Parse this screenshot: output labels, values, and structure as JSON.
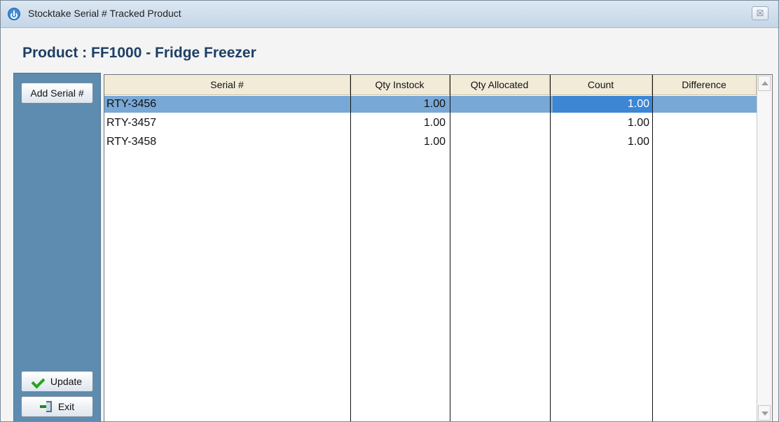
{
  "window": {
    "title": "Stocktake Serial # Tracked Product",
    "close_symbol": "☒"
  },
  "product_heading": "Product : FF1000 - Fridge Freezer",
  "buttons": {
    "add_serial": "Add Serial #",
    "update": "Update",
    "exit": "Exit"
  },
  "table": {
    "columns": [
      "Serial #",
      "Qty Instock",
      "Qty Allocated",
      "Count",
      "Difference"
    ],
    "rows": [
      {
        "serial": "RTY-3456",
        "qty_instock": "1.00",
        "qty_allocated": "",
        "count": "1.00",
        "difference": ""
      },
      {
        "serial": "RTY-3457",
        "qty_instock": "1.00",
        "qty_allocated": "",
        "count": "1.00",
        "difference": ""
      },
      {
        "serial": "RTY-3458",
        "qty_instock": "1.00",
        "qty_allocated": "",
        "count": "1.00",
        "difference": ""
      }
    ]
  },
  "colors": {
    "selected_row": "#78a8d6",
    "selected_cell": "#3c86d4",
    "left_panel": "#5d8cb0"
  }
}
